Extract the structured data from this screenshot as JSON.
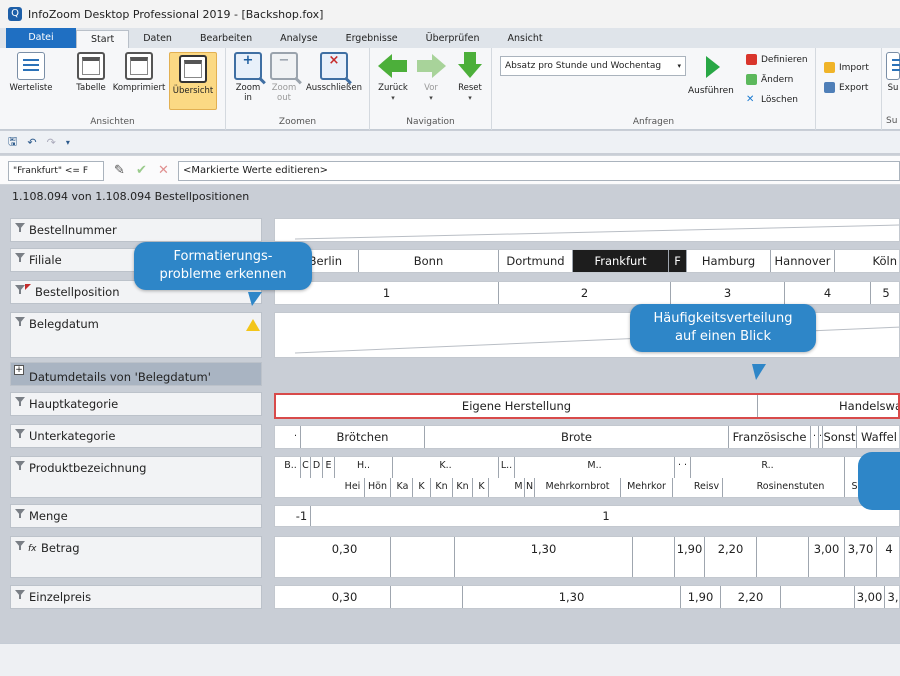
{
  "window": {
    "title": "InfoZoom Desktop Professional 2019 - [Backshop.fox]",
    "app_icon": "Q"
  },
  "tabs": [
    {
      "label": "Datei"
    },
    {
      "label": "Start"
    },
    {
      "label": "Daten"
    },
    {
      "label": "Bearbeiten"
    },
    {
      "label": "Analyse"
    },
    {
      "label": "Ergebnisse"
    },
    {
      "label": "Überprüfen"
    },
    {
      "label": "Ansicht"
    }
  ],
  "ribbon": {
    "views": {
      "label": "Ansichten",
      "buttons": [
        {
          "label": "Werteliste"
        },
        {
          "label": "Tabelle"
        },
        {
          "label": "Komprimiert"
        },
        {
          "label": "Übersicht"
        }
      ]
    },
    "zoom": {
      "label": "Zoomen",
      "buttons": [
        {
          "label": "Zoom in",
          "line1": "Zoom",
          "line2": "in"
        },
        {
          "label": "Zoom out",
          "line1": "Zoom",
          "line2": "out"
        },
        {
          "label": "Ausschließen"
        }
      ]
    },
    "navigation": {
      "label": "Navigation",
      "buttons": [
        {
          "label": "Zurück"
        },
        {
          "label": "Vor"
        },
        {
          "label": "Reset"
        }
      ]
    },
    "queries": {
      "label": "Anfragen",
      "combo_value": "Absatz pro Stunde und Wochentag",
      "run_label": "Ausführen",
      "define_label": "Definieren",
      "change_label": "Ändern",
      "delete_label": "Löschen"
    },
    "io": {
      "import_label": "Import",
      "export_label": "Export",
      "more_label": "Su"
    },
    "cut_label": "Su"
  },
  "filterbar": {
    "condition": "\"Frankfurt\" <= F",
    "placeholder": "<Markierte Werte editieren>"
  },
  "status": {
    "text": "1.108.094 von 1.108.094 Bestellpositionen"
  },
  "attributes": {
    "bestellnummer": "Bestellnummer",
    "filiale": "Filiale",
    "bestellposition": "Bestellposition",
    "belegdatum": "Belegdatum",
    "datumdetails": "Datumdetails von 'Belegdatum'",
    "hauptkategorie": "Hauptkategorie",
    "unterkategorie": "Unterkategorie",
    "produktbezeichnung": "Produktbezeichnung",
    "menge": "Menge",
    "betrag": "Betrag",
    "einzelpreis": "Einzelpreis"
  },
  "values": {
    "filiale": [
      "Berlin",
      "Bonn",
      "Dortmund",
      "Frankfurt",
      "F",
      "Hamburg",
      "Hannover",
      "Köln"
    ],
    "bestellposition": [
      "1",
      "2",
      "3",
      "4",
      "5"
    ],
    "hauptkategorie": [
      "Eigene Herstellung",
      "Handelswa"
    ],
    "unterkategorie": [
      "·",
      "Brötchen",
      "Brote",
      "Französische",
      "·",
      "·",
      "Sonst",
      "Waffel"
    ],
    "produkt_top": [
      "B..",
      "C",
      "D",
      "E",
      "H..",
      "K..",
      "L..",
      "M..",
      "· ·",
      "R.."
    ],
    "produkt_bottom": [
      "Hei",
      "Hön",
      "Ka",
      "K",
      "Kn",
      "Kn",
      "K",
      "M",
      "N",
      "Mehrkornbrot",
      "Mehrkor",
      "Reisv",
      "Rosinenstuten",
      "S"
    ],
    "menge": [
      "-1",
      "1"
    ],
    "betrag": [
      "0,30",
      "1,30",
      "1,90",
      "2,20",
      "3,00",
      "3,70",
      "4"
    ],
    "einzelpreis": [
      "0,30",
      "1,30",
      "1,90",
      "2,20",
      "3,00",
      "3,"
    ]
  },
  "callouts": {
    "format": "Formatierungs-\nprobleme erkennen",
    "haeufigkeit": "Häufigkeitsverteilung\nauf einen Blick"
  }
}
